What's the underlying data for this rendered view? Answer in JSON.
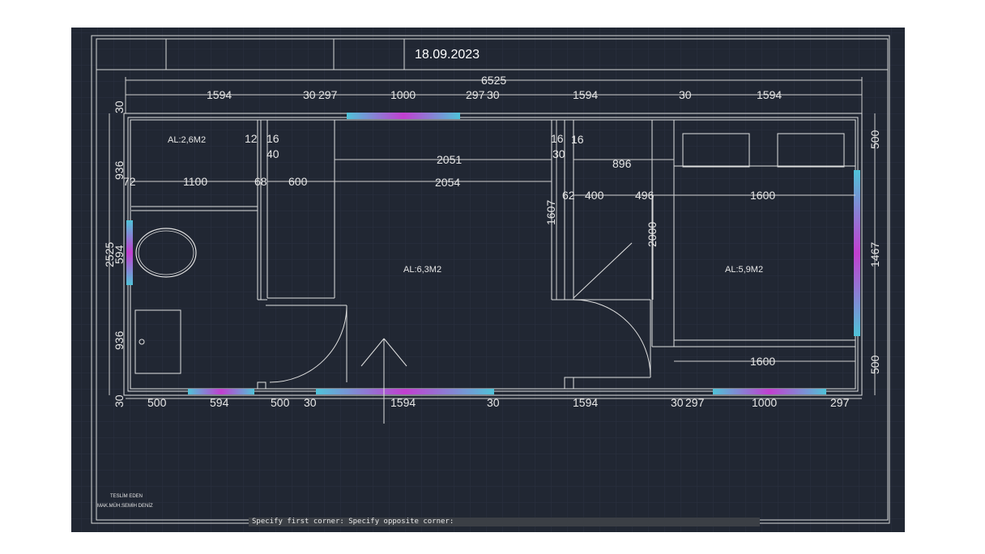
{
  "title_block": {
    "date": "18.09.2023"
  },
  "dimensions": {
    "top": {
      "total": "6525",
      "segments": [
        "1594",
        "30",
        "297",
        "1000",
        "297",
        "30",
        "1594",
        "30",
        "1594"
      ]
    },
    "bottom": {
      "segments": [
        "500",
        "594",
        "500",
        "30",
        "1594",
        "30",
        "1594",
        "30",
        "297",
        "1000",
        "297"
      ]
    },
    "left": {
      "outer": "30",
      "upper": "936",
      "total": "2525",
      "window": "594",
      "lower": "936",
      "bottom_outer": "30"
    },
    "right": {
      "upper": "500",
      "window": "1467",
      "lower": "500"
    },
    "interior": {
      "wc_width": "1100",
      "wc_left": "72",
      "wc_wall": "68",
      "closet": "600",
      "wall_a": "12",
      "wall_b": "16",
      "wall_c": "40",
      "living_upper": "2051",
      "living_lower": "2054",
      "mid_wall_a": "16",
      "mid_wall_b": "16",
      "mid_wall_c": "30",
      "hall_width": "896",
      "mid_62": "62",
      "mid_400": "400",
      "mid_496": "496",
      "bed_width_top": "1600",
      "bed_width_bottom": "1600",
      "bed_length": "2000",
      "hall_length": "1607"
    }
  },
  "rooms": {
    "bathroom": "AL:2,6M2",
    "living": "AL:6,3M2",
    "bedroom": "AL:5,9M2"
  },
  "footer": {
    "delivered_by": "TESLİM EDEN",
    "engineer": "MAK.MÜH.SEMİH DENİZ"
  },
  "command_line": {
    "text": "Specify first corner: Specify opposite corner:"
  }
}
